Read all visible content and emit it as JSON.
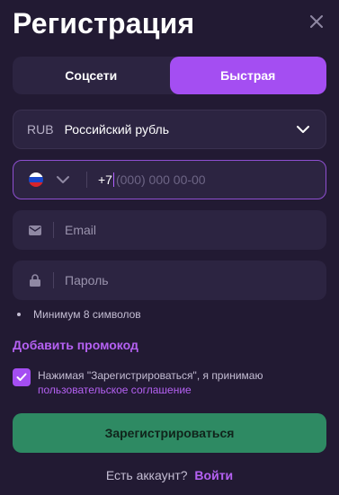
{
  "modal": {
    "title": "Регистрация",
    "close_icon": "close-icon"
  },
  "tabs": [
    {
      "label": "Соцсети",
      "active": false
    },
    {
      "label": "Быстрая",
      "active": true
    }
  ],
  "currency": {
    "code": "RUB",
    "name": "Российский рубль",
    "icon": "chevron-down-icon"
  },
  "phone": {
    "country_flag": "russia-flag-icon",
    "prefix": "+7",
    "placeholder": "(000) 000 00-00"
  },
  "email": {
    "icon": "envelope-icon",
    "placeholder": "Email"
  },
  "password": {
    "icon": "lock-icon",
    "placeholder": "Пароль",
    "hint": "Минимум 8 символов"
  },
  "promo": {
    "label": "Добавить промокод"
  },
  "agreement": {
    "checked": true,
    "text": "Нажимая \"Зарегистрироваться\", я принимаю",
    "link": "пользовательское соглашение"
  },
  "submit": {
    "label": "Зарегистрироваться"
  },
  "login": {
    "question": "Есть аккаунт?",
    "link": "Войти"
  },
  "colors": {
    "background": "#221a33",
    "field": "#2c2441",
    "accent": "#a44ef2",
    "link": "#b561f3",
    "submit": "#2e8a63"
  }
}
